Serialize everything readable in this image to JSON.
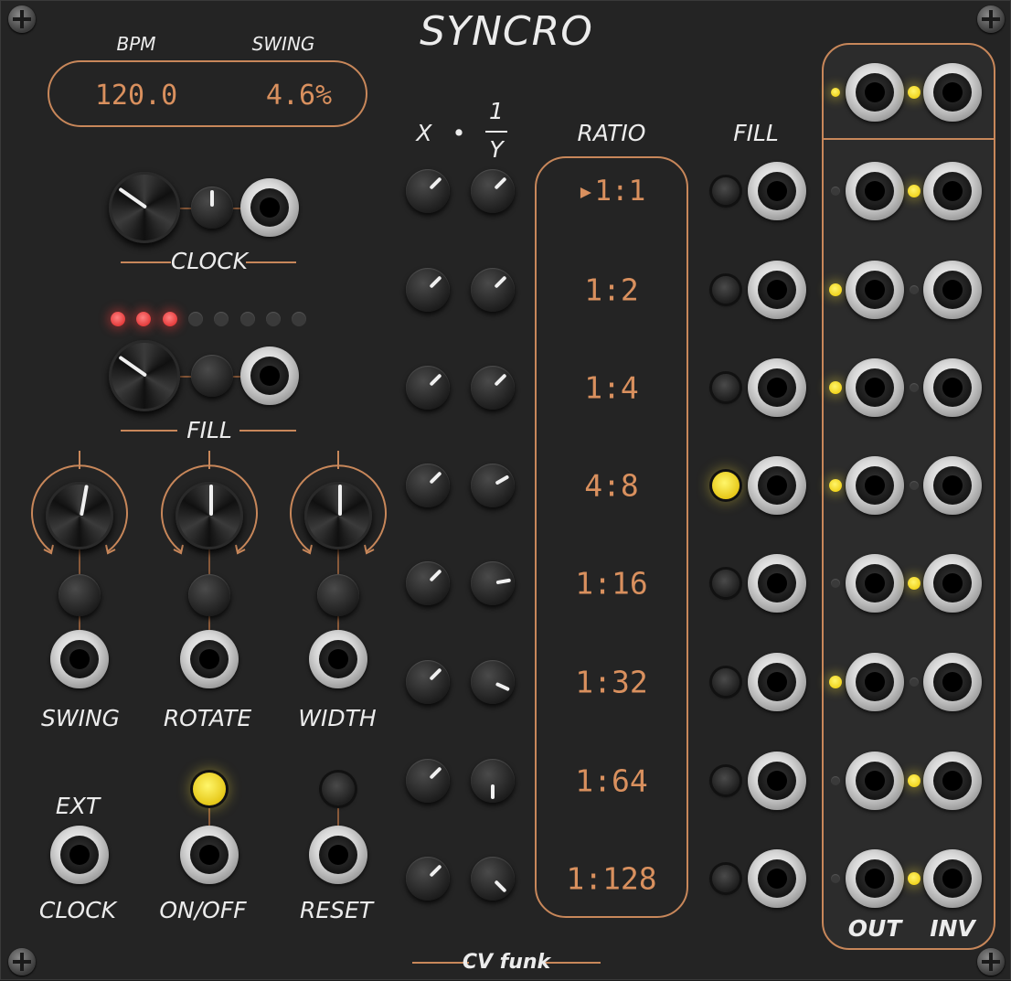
{
  "module": {
    "title": "SYNCRO",
    "brand": "CV funk"
  },
  "display": {
    "bpm_label": "BPM",
    "swing_label": "SWING",
    "bpm_value": "120.0",
    "swing_value": "4.6%"
  },
  "left": {
    "clock_label": "CLOCK",
    "fill_label": "FILL",
    "swing_label": "SWING",
    "rotate_label": "ROTATE",
    "width_label": "WIDTH",
    "ext_label": "EXT",
    "ext_clock_label": "CLOCK",
    "onoff_label": "ON/OFF",
    "reset_label": "RESET",
    "fill_leds_lit": 3,
    "fill_leds_total": 8
  },
  "columns": {
    "x_label": "X",
    "dot_label": "•",
    "one_label": "1",
    "y_label": "Y",
    "ratio_header": "RATIO",
    "fill_header": "FILL",
    "out_label": "OUT",
    "inv_label": "INV"
  },
  "ratios": [
    {
      "marker": "▸",
      "value": "1:1"
    },
    {
      "marker": "",
      "value": "1:2"
    },
    {
      "marker": "",
      "value": "1:4"
    },
    {
      "marker": "",
      "value": "4:8"
    },
    {
      "marker": "",
      "value": "1:16"
    },
    {
      "marker": "",
      "value": "1:32"
    },
    {
      "marker": "",
      "value": "1:64"
    },
    {
      "marker": "",
      "value": "1:128"
    }
  ],
  "fill_buttons_on": [
    false,
    false,
    false,
    true,
    false,
    false,
    false,
    false
  ],
  "out_leds_on": [
    true,
    false,
    true,
    true,
    true,
    false,
    true,
    false,
    false
  ],
  "inv_leds_on": [
    false,
    true,
    false,
    false,
    false,
    true,
    false,
    true,
    true
  ],
  "colors": {
    "accent": "#c8875a",
    "display_text": "#d9905e",
    "led_red": "#e63c3c",
    "led_yellow": "#f1d41e",
    "panel": "#242424"
  }
}
